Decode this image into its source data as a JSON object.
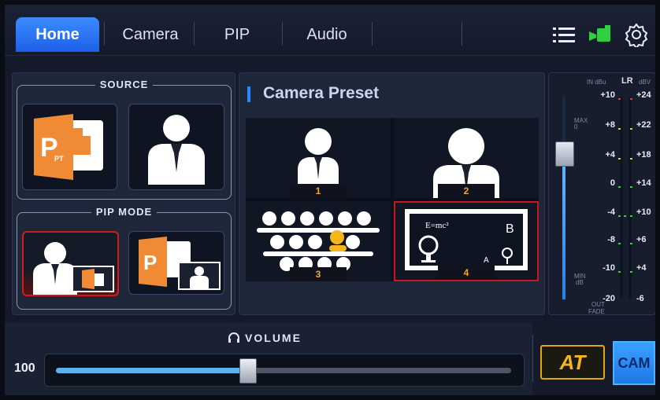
{
  "tabs": [
    {
      "label": "Home",
      "active": true
    },
    {
      "label": "Camera",
      "active": false
    },
    {
      "label": "PIP",
      "active": false
    },
    {
      "label": "Audio",
      "active": false
    }
  ],
  "top_icons": [
    "list-icon",
    "camera-status-icon",
    "gear-icon"
  ],
  "source": {
    "title": "SOURCE",
    "tiles": [
      {
        "name": "ppt-source",
        "icon": "ppt-icon",
        "badge": "PT"
      },
      {
        "name": "camera-source",
        "icon": "person-icon"
      }
    ]
  },
  "pip_mode": {
    "title": "PIP MODE",
    "tiles": [
      {
        "name": "pip-camera-main",
        "selected": true
      },
      {
        "name": "pip-ppt-main",
        "selected": false
      }
    ]
  },
  "preset": {
    "title": "Camera Preset",
    "items": [
      {
        "number": "1",
        "selected": false
      },
      {
        "number": "2",
        "selected": false
      },
      {
        "number": "3",
        "selected": false
      },
      {
        "number": "4",
        "selected": true,
        "board_text": [
          "E=mc²",
          "B",
          "A"
        ]
      }
    ]
  },
  "meter": {
    "header_in": "IN dBu",
    "header_lr": "LR",
    "header_dbv": "dBV",
    "max_label": "MAX",
    "max_value": "0",
    "min_label": "MIN",
    "min_value": "dB",
    "out_label": "OUT",
    "fade_label": "FADE",
    "left_scale": [
      "+10",
      "+8",
      "+4",
      "0",
      "-4",
      "-8",
      "-10",
      "-20"
    ],
    "right_scale": [
      "+24",
      "+22",
      "+18",
      "+14",
      "+10",
      "+6",
      "+4",
      "-6"
    ],
    "fader_level": 0.72
  },
  "volume": {
    "title": "VOLUME",
    "value": "100",
    "level": 0.42
  },
  "buttons": {
    "at": "AT",
    "cam": "CAM"
  },
  "colors": {
    "accent": "#2b86ff",
    "ppt_orange": "#f08a34",
    "selection_red": "#d31b1b",
    "at_gold": "#e3a512"
  }
}
